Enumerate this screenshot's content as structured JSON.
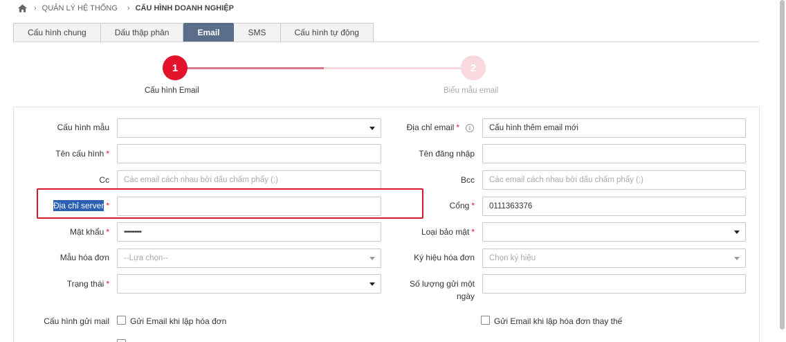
{
  "breadcrumb": {
    "items": [
      "QUẢN LÝ HỆ THỐNG",
      "CẤU HÌNH DOANH NGHIỆP"
    ]
  },
  "tabs": [
    {
      "label": "Cấu hình chung",
      "active": false
    },
    {
      "label": "Dấu thập phân",
      "active": false
    },
    {
      "label": "Email",
      "active": true
    },
    {
      "label": "SMS",
      "active": false
    },
    {
      "label": "Cấu hình tự động",
      "active": false
    }
  ],
  "stepper": {
    "steps": [
      {
        "number": "1",
        "label": "Cấu hình Email"
      },
      {
        "number": "2",
        "label": "Biểu mẫu email"
      }
    ]
  },
  "form": {
    "cau_hinh_mau": {
      "label": "Cấu hình mẫu",
      "value": ""
    },
    "dia_chi_email": {
      "label": "Địa chỉ email",
      "value": "Cấu hình thêm email mới",
      "required": "*"
    },
    "ten_cau_hinh": {
      "label": "Tên cấu hình",
      "value": "",
      "required": "*"
    },
    "ten_dang_nhap": {
      "label": "Tên đăng nhập",
      "value": ""
    },
    "cc": {
      "label": "Cc",
      "placeholder": "Các email cách nhau bởi dấu chấm phẩy (;)"
    },
    "bcc": {
      "label": "Bcc",
      "placeholder": "Các email cách nhau bởi dấu chấm phẩy (;)"
    },
    "dia_chi_server": {
      "label": "Địa chỉ server",
      "value": "",
      "required": "*"
    },
    "cong": {
      "label": "Cổng",
      "value": "0111363376",
      "required": "*"
    },
    "mat_khau": {
      "label": "Mật khẩu",
      "value": "••••••••••",
      "required": "*"
    },
    "loai_bao_mat": {
      "label": "Loại bảo mật",
      "value": "",
      "required": "*"
    },
    "mau_hoa_don": {
      "label": "Mẫu hóa đơn",
      "placeholder": "--Lựa chọn--"
    },
    "ky_hieu_hoa_don": {
      "label": "Ký hiệu hóa đơn",
      "placeholder": "Chọn ký hiệu"
    },
    "trang_thai": {
      "label": "Trạng thái",
      "value": "",
      "required": "*"
    },
    "so_luong_gui": {
      "label_line1": "Số lượng gửi một",
      "label_line2": "ngày",
      "value": ""
    },
    "cau_hinh_gui_mail": {
      "label": "Cấu hình gửi mail",
      "opt1": "Gửi Email khi lập hóa đơn",
      "opt2": "Gửi Email khi lập hóa đơn thay thế"
    }
  },
  "colors": {
    "accent": "#e3132b",
    "tab_active": "#5a6d8a",
    "selection": "#2b5fb4",
    "highlight_box": "#d61a2b"
  }
}
